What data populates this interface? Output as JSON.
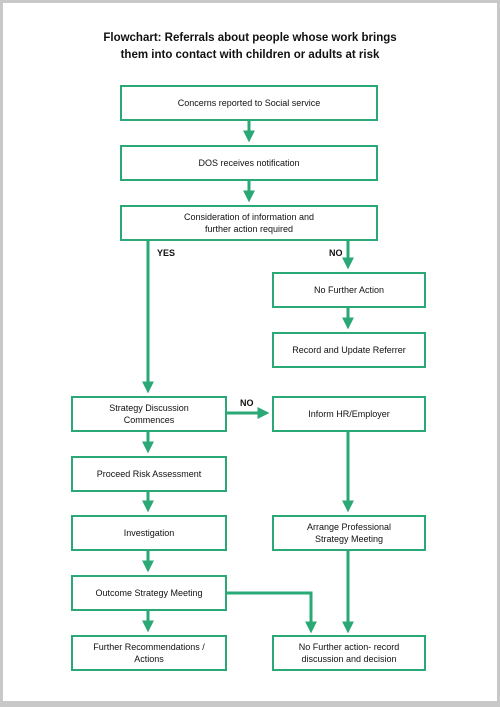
{
  "title": {
    "line1": "Flowchart: Referrals about people whose work brings",
    "line2": "them into contact with children or adults at risk"
  },
  "colors": {
    "accent": "#2aa876",
    "text": "#111111",
    "frame": "#c8c8c8"
  },
  "nodes": {
    "concerns": {
      "lines": [
        "Concerns reported to Social service"
      ]
    },
    "dos": {
      "lines": [
        "DOS receives notification"
      ]
    },
    "consideration": {
      "lines": [
        "Consideration of information and",
        "further action required"
      ]
    },
    "no_further_action": {
      "lines": [
        "No Further Action"
      ]
    },
    "record_update": {
      "lines": [
        "Record and Update Referrer"
      ]
    },
    "strategy_discussion": {
      "lines": [
        "Strategy Discussion",
        "Commences"
      ]
    },
    "inform_hr": {
      "lines": [
        "Inform HR/Employer"
      ]
    },
    "proceed_risk": {
      "lines": [
        "Proceed Risk Assessment"
      ]
    },
    "investigation": {
      "lines": [
        "Investigation"
      ]
    },
    "arrange_meeting": {
      "lines": [
        "Arrange Professional",
        "Strategy Meeting"
      ]
    },
    "outcome_meeting": {
      "lines": [
        "Outcome Strategy Meeting"
      ]
    },
    "further_recommendations": {
      "lines": [
        "Further Recommendations /",
        "Actions"
      ]
    },
    "no_further_record": {
      "lines": [
        "No Further action- record",
        "discussion and decision"
      ]
    }
  },
  "edge_labels": {
    "yes": "YES",
    "no_consideration": "NO",
    "no_strategy": "NO"
  },
  "edges": [
    {
      "from": "concerns",
      "to": "dos"
    },
    {
      "from": "dos",
      "to": "consideration"
    },
    {
      "from": "consideration",
      "to": "strategy_discussion",
      "label": "YES"
    },
    {
      "from": "consideration",
      "to": "no_further_action",
      "label": "NO"
    },
    {
      "from": "no_further_action",
      "to": "record_update"
    },
    {
      "from": "strategy_discussion",
      "to": "inform_hr",
      "label": "NO"
    },
    {
      "from": "strategy_discussion",
      "to": "proceed_risk"
    },
    {
      "from": "proceed_risk",
      "to": "investigation"
    },
    {
      "from": "investigation",
      "to": "outcome_meeting"
    },
    {
      "from": "outcome_meeting",
      "to": "further_recommendations"
    },
    {
      "from": "outcome_meeting",
      "to": "no_further_record"
    },
    {
      "from": "inform_hr",
      "to": "arrange_meeting"
    },
    {
      "from": "arrange_meeting",
      "to": "no_further_record"
    }
  ]
}
